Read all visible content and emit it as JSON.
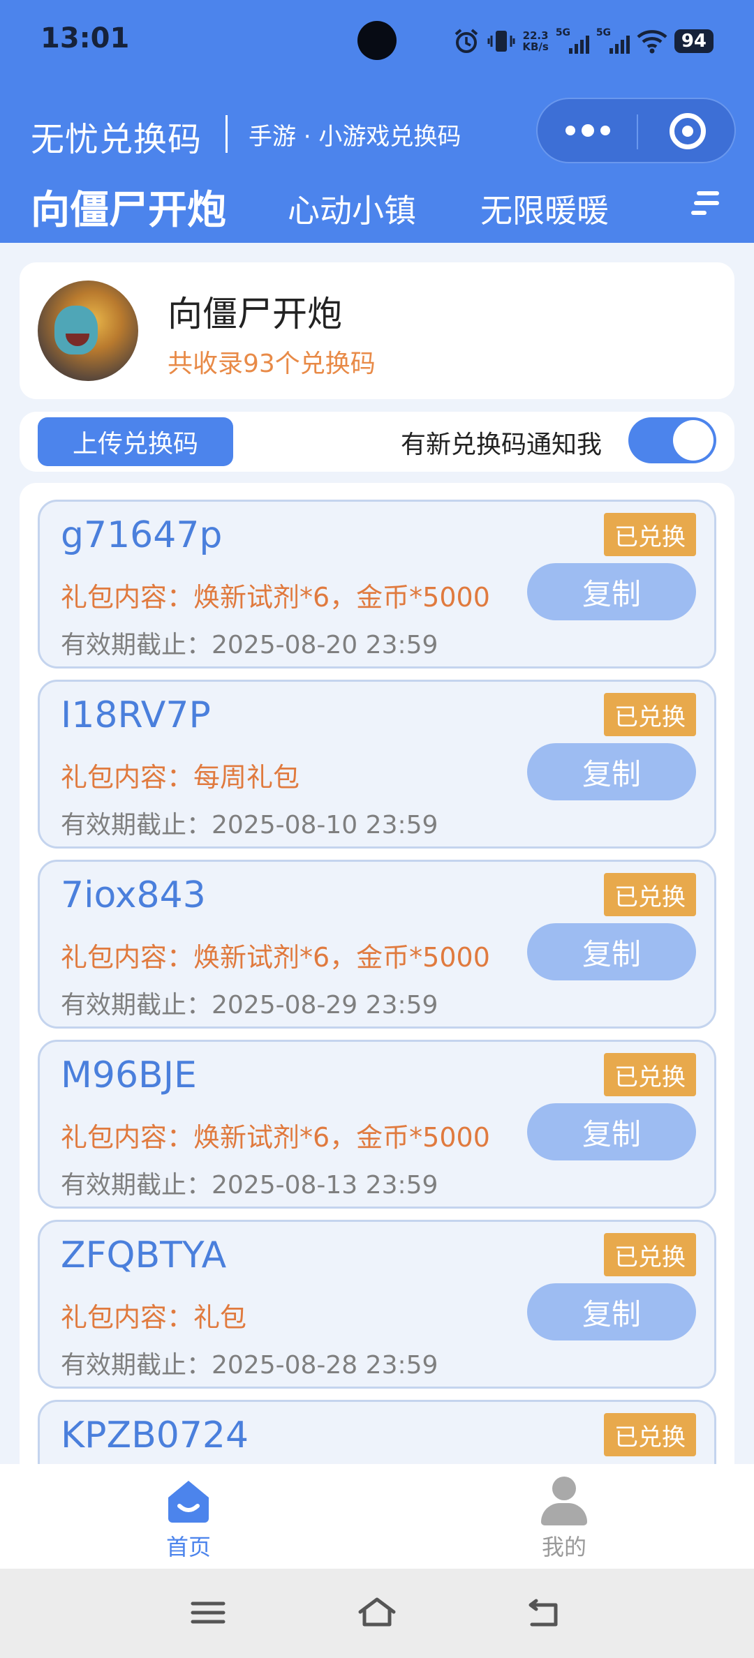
{
  "status_bar": {
    "time": "13:01",
    "net_speed_value": "22.3",
    "net_speed_unit": "KB/s",
    "signal1_label": "5G",
    "signal2_label": "5G",
    "battery": "94",
    "icons": [
      "alarm-icon",
      "vibrate-icon",
      "wifi-icon"
    ]
  },
  "header": {
    "app_title": "无忧兑换码",
    "subtitle": "手游 · 小游戏兑换码",
    "tabs": [
      {
        "label": "向僵尸开炮",
        "active": true
      },
      {
        "label": "心动小镇",
        "active": false
      },
      {
        "label": "无限暖暖",
        "active": false
      }
    ],
    "accent_color": "#4c84ec"
  },
  "game": {
    "name": "向僵尸开炮",
    "count_text": "共收录93个兑换码"
  },
  "toolbar": {
    "upload_label": "上传兑换码",
    "notify_label": "有新兑换码通知我",
    "notify_on": true
  },
  "codes": [
    {
      "code": "g71647p",
      "badge": "已兑换",
      "gift": "礼包内容：焕新试剂*6，金币*5000",
      "copy": "复制",
      "expiry": "有效期截止：2025-08-20 23:59"
    },
    {
      "code": "I18RV7P",
      "badge": "已兑换",
      "gift": "礼包内容：每周礼包",
      "copy": "复制",
      "expiry": "有效期截止：2025-08-10 23:59"
    },
    {
      "code": "7iox843",
      "badge": "已兑换",
      "gift": "礼包内容：焕新试剂*6，金币*5000",
      "copy": "复制",
      "expiry": "有效期截止：2025-08-29 23:59"
    },
    {
      "code": "M96BJE",
      "badge": "已兑换",
      "gift": "礼包内容：焕新试剂*6，金币*5000",
      "copy": "复制",
      "expiry": "有效期截止：2025-08-13 23:59"
    },
    {
      "code": "ZFQBTYA",
      "badge": "已兑换",
      "gift": "礼包内容：礼包",
      "copy": "复制",
      "expiry": "有效期截止：2025-08-28 23:59"
    },
    {
      "code": "KPZB0724",
      "badge": "已兑换",
      "gift": "",
      "copy": "",
      "expiry": ""
    }
  ],
  "bottom_nav": {
    "home_label": "首页",
    "mine_label": "我的",
    "active_color": "#4c84ec",
    "inactive_color": "#9a9a9a"
  }
}
